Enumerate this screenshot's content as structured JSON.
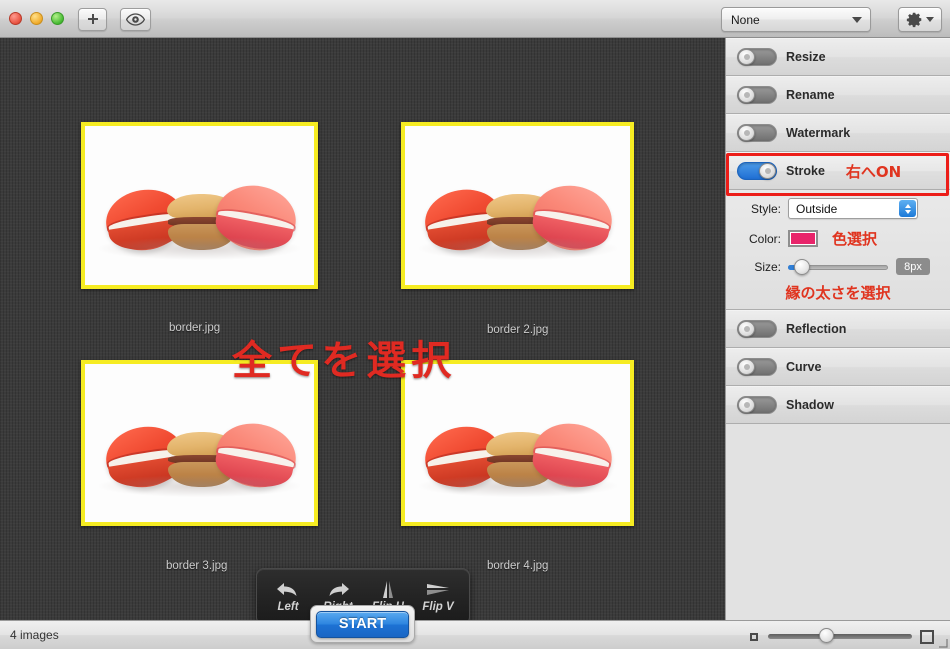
{
  "window": {
    "traffic_lights": [
      "close",
      "minimize",
      "zoom"
    ],
    "toolbar": {
      "add_label": "+",
      "add_icon": "plus-icon",
      "preview_icon": "eye-icon",
      "preset_popup_value": "None",
      "gear_icon": "gear-icon"
    }
  },
  "canvas": {
    "thumbnails": [
      {
        "label": "border.jpg",
        "selected": true,
        "stroke_color": "#f6ec22"
      },
      {
        "label": "border 2.jpg",
        "selected": true,
        "stroke_color": "#f6ec22"
      },
      {
        "label": "border 3.jpg",
        "selected": true,
        "stroke_color": "#f6ec22"
      },
      {
        "label": "border 4.jpg",
        "selected": true,
        "stroke_color": "#f6ec22"
      }
    ],
    "annotation_select_all": "全てを選択",
    "rotate_toolbar": [
      {
        "label": "Left",
        "icon": "rotate-left-icon"
      },
      {
        "label": "Right",
        "icon": "rotate-right-icon"
      },
      {
        "label": "Flip H",
        "icon": "flip-horizontal-icon"
      },
      {
        "label": "Flip V",
        "icon": "flip-vertical-icon"
      }
    ]
  },
  "sidebar": {
    "toggles_top": [
      {
        "label": "Resize",
        "on": false
      },
      {
        "label": "Rename",
        "on": false
      },
      {
        "label": "Watermark",
        "on": false
      }
    ],
    "stroke": {
      "label": "Stroke",
      "on": true,
      "annotation": "右へON",
      "style_label": "Style:",
      "style_value": "Outside",
      "color_label": "Color:",
      "color_value": "#e8246a",
      "color_annotation": "色選択",
      "size_label": "Size:",
      "size_value": "8px",
      "size_annotation": "縁の太さを選択"
    },
    "toggles_bottom": [
      {
        "label": "Reflection",
        "on": false
      },
      {
        "label": "Curve",
        "on": false
      },
      {
        "label": "Shadow",
        "on": false
      }
    ]
  },
  "statusbar": {
    "images_count": "4 images",
    "start_label": "START",
    "zoom_small_icon": "small-thumbnail-icon",
    "zoom_large_icon": "large-thumbnail-icon"
  },
  "colors": {
    "accent_blue": "#2e85e0",
    "annotation_red": "#e0341f",
    "highlight_red": "#ec1d18",
    "stroke_yellow": "#f6ec22",
    "canvas_bg": "#3b3b3b"
  }
}
